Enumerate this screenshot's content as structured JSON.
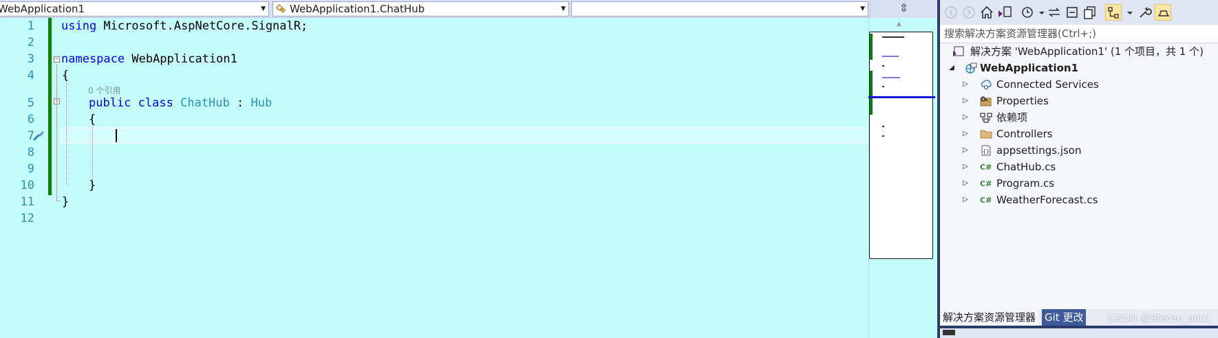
{
  "nav": {
    "project_dropdown": "WebApplication1",
    "type_dropdown": "WebApplication1.ChatHub",
    "member_dropdown": ""
  },
  "editor": {
    "line_numbers": [
      "1",
      "2",
      "3",
      "4",
      "5",
      "6",
      "7",
      "8",
      "9",
      "10",
      "11",
      "12"
    ],
    "reference_hint": "0 个引用",
    "code": {
      "l1_kw": "using",
      "l1_rest": " Microsoft.AspNetCore.SignalR;",
      "l3_kw": "namespace",
      "l3_rest": " WebApplication1",
      "l4": "{",
      "l5_kw1": "public",
      "l5_kw2": "class",
      "l5_type": "ChatHub",
      "l5_colon": " : ",
      "l5_base": "Hub",
      "l6": "{",
      "l10": "}",
      "l11": "}"
    }
  },
  "solution_explorer": {
    "search_placeholder": "搜索解决方案资源管理器(Ctrl+;)",
    "solution_label": "解决方案 'WebApplication1' (1 个项目，共 1 个)",
    "project_label": "WebApplication1",
    "items": [
      {
        "label": "Connected Services",
        "icon": "connected-services-icon"
      },
      {
        "label": "Properties",
        "icon": "properties-icon"
      },
      {
        "label": "依赖项",
        "icon": "dependencies-icon"
      },
      {
        "label": "Controllers",
        "icon": "folder-icon"
      },
      {
        "label": "appsettings.json",
        "icon": "json-file-icon"
      },
      {
        "label": "ChatHub.cs",
        "icon": "csharp-file-icon"
      },
      {
        "label": "Program.cs",
        "icon": "csharp-file-icon"
      },
      {
        "label": "WeatherForecast.cs",
        "icon": "csharp-file-icon"
      }
    ],
    "tabs": {
      "active": "解决方案资源管理器",
      "inactive": "Git 更改"
    }
  },
  "watermark": "CSDN @Steven_ann1",
  "colors": {
    "editor_bg": "#c4fcfc",
    "keyword": "#0000ff",
    "type": "#2b91af",
    "change_bar": "#107c10",
    "accent": "#2b3b6a"
  }
}
